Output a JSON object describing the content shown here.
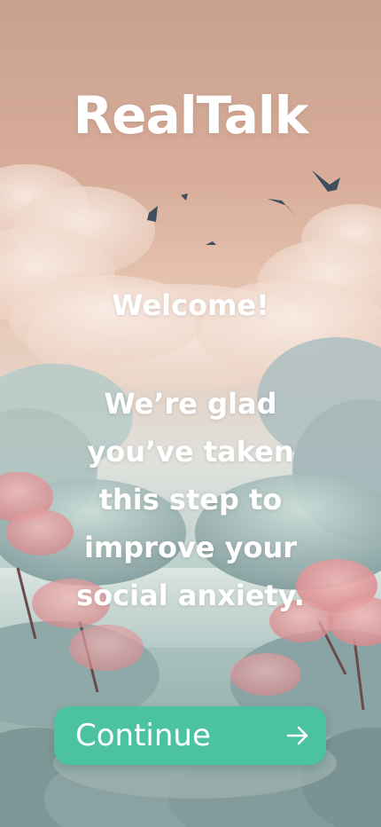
{
  "app": {
    "title": "RealTalk"
  },
  "welcome": {
    "heading": "Welcome!",
    "message": "We’re glad you’ve taken this step to improve your social anxiety."
  },
  "continue_button": {
    "label": "Continue",
    "icon": "arrow-right-icon"
  },
  "colors": {
    "accent": "#4cc3a0",
    "text": "#ffffff",
    "sky_top": "#c99f8f",
    "sky_horizon": "#e9c8b5",
    "foliage": "#9fb8b4"
  }
}
